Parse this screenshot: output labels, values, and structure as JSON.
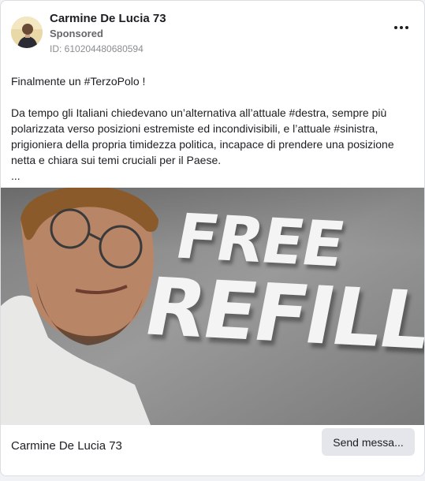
{
  "advertiser": {
    "name": "Carmine De Lucia 73",
    "sponsored_label": "Sponsored",
    "id_label": "ID: 610204480680594"
  },
  "menu_icon": "more-horizontal-icon",
  "post": {
    "line1": "Finalmente un #TerzoPolo !",
    "paragraph": "Da tempo gli Italiani chiedevano un’alternativa all’attuale #destra, sempre più polarizzata verso posizioni estremiste ed incondivisibili, e l’attuale #sinistra, prigioniera della propria timidezza politica, incapace di prendere una posizione netta e chiara sui temi cruciali per il Paese.",
    "ellipsis": "..."
  },
  "image": {
    "wall_line1": "FREE",
    "wall_line2": "REFILL"
  },
  "footer": {
    "page_name": "Carmine De Lucia 73",
    "cta_label": "Send messa..."
  }
}
